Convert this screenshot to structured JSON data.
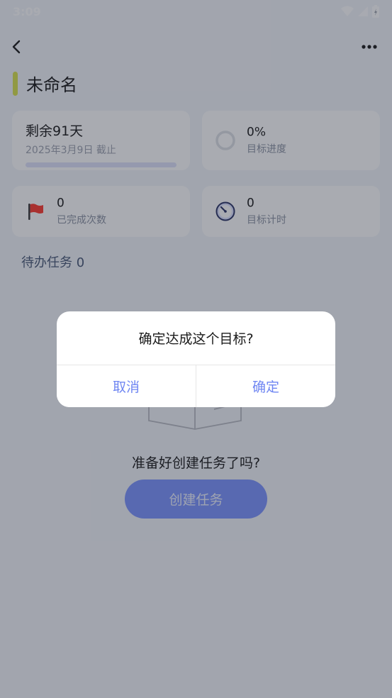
{
  "status_bar": {
    "time": "3:09"
  },
  "goal": {
    "title": "未命名",
    "accent_color": "#d9e24e"
  },
  "days_card": {
    "remaining": "剩余91天",
    "deadline": "2025年3月9日 截止",
    "progress": 0
  },
  "progress_card": {
    "value": "0%",
    "label": "目标进度"
  },
  "completed_card": {
    "value": "0",
    "label": "已完成次数",
    "icon": "red-flag-icon"
  },
  "timer_card": {
    "value": "0",
    "label": "目标计时",
    "icon": "clock-icon"
  },
  "todo": {
    "heading": "待办任务 0"
  },
  "empty_state": {
    "message": "准备好创建任务了吗?",
    "create_label": "创建任务"
  },
  "dialog": {
    "message": "确定达成这个目标?",
    "cancel_label": "取消",
    "confirm_label": "确定"
  },
  "colors": {
    "primary": "#7d95ff",
    "dialog_action": "#6f86f2"
  }
}
